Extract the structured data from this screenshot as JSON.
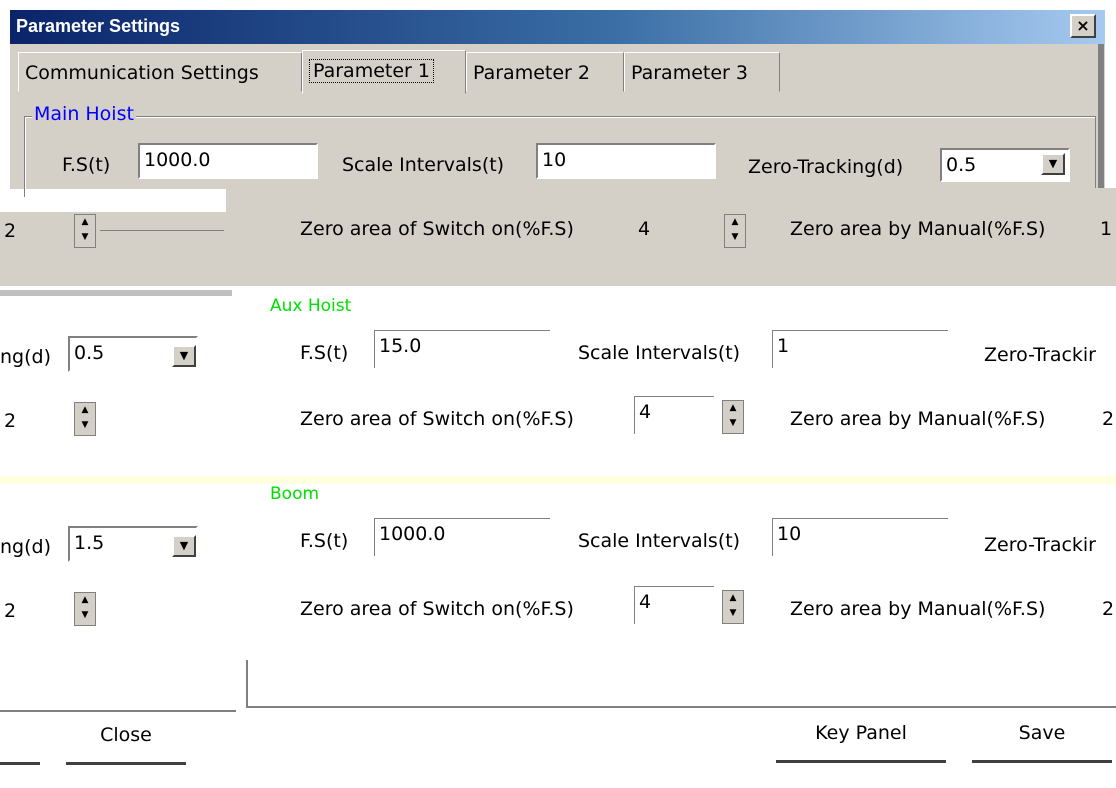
{
  "window": {
    "title": "Parameter Settings",
    "close_label": "×"
  },
  "tabs": [
    {
      "label": "Communication Settings"
    },
    {
      "label": "Parameter 1"
    },
    {
      "label": "Parameter 2"
    },
    {
      "label": "Parameter 3"
    }
  ],
  "main_hoist": {
    "legend": "Main Hoist",
    "fs_label": "F.S(t)",
    "fs_value": "1000.0",
    "scale_label": "Scale Intervals(t)",
    "scale_value": "10",
    "zt_label": "Zero-Tracking(d)",
    "zt_value": "0.5",
    "left_value": "2",
    "zs_label": "Zero area of Switch on(%F.S)",
    "zs_value": "4",
    "zm_label": "Zero area by Manual(%F.S)",
    "zm_value": "1"
  },
  "aux_hoist": {
    "legend": "Aux Hoist",
    "zt_label_partial": "ng(d)",
    "zt_value": "0.5",
    "fs_label": "F.S(t)",
    "fs_value": "15.0",
    "scale_label": "Scale Intervals(t)",
    "scale_value": "1",
    "zt_label_right": "Zero-Trackir",
    "left_value": "2",
    "zs_label": "Zero area of Switch on(%F.S)",
    "zs_value": "4",
    "zm_label": "Zero area by Manual(%F.S)",
    "zm_value": "2"
  },
  "boom": {
    "legend": "Boom",
    "zt_label_partial": "ng(d)",
    "zt_value": "1.5",
    "fs_label": "F.S(t)",
    "fs_value": "1000.0",
    "scale_label": "Scale Intervals(t)",
    "scale_value": "10",
    "zt_label_right": "Zero-Trackir",
    "left_value": "2",
    "zs_label": "Zero area of Switch on(%F.S)",
    "zs_value": "4",
    "zm_label": "Zero area by Manual(%F.S)",
    "zm_value": "2"
  },
  "buttons": {
    "close": "Close",
    "key_panel": "Key Panel",
    "save": "Save"
  },
  "icons": {
    "dropdown": "▼",
    "spin_up": "▲",
    "spin_down": "▼"
  }
}
